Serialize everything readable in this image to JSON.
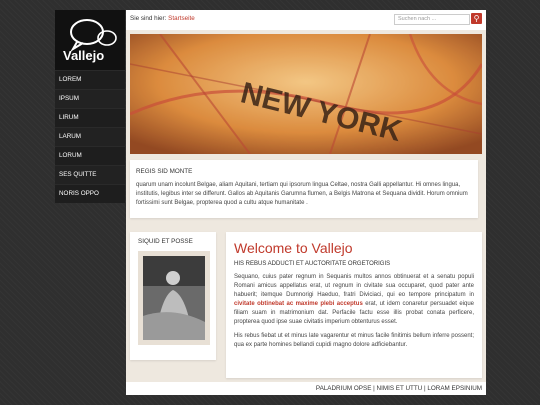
{
  "logo": {
    "text": "Vallejo"
  },
  "nav": [
    "LOREM",
    "IPSUM",
    "LIRUM",
    "LARUM",
    "LORUM",
    "SES QUITTE",
    "NORIS OPPO"
  ],
  "breadcrumb": {
    "label": "Sie sind hier:",
    "link": "Startseite"
  },
  "search": {
    "placeholder": "Suchen nach ..."
  },
  "hero": {
    "text": "NEW YORK"
  },
  "intro": {
    "heading": "REGIS SID MONTE",
    "text": "quarum unam incolunt Belgae, aliam Aquitani, tertiam qui ipsorum lingua Celtae, nostra Galli appellantur. Hi omnes lingua, institutis, legibus inter se differunt. Gallos ab Aquitanis Garumna flumen, a Belgis Matrona et Sequana dividit. Horum omnium fortissimi sunt Belgae, propterea quod a cultu atque humanitate ."
  },
  "side": {
    "heading": "SIQUID ET POSSE"
  },
  "main": {
    "title": "Welcome to Vallejo",
    "subtitle": "HIS REBUS ADDUCTI ET AUCTORITATE ORGETORIGIS",
    "p1_a": "Sequano, cuius pater regnum in Sequanis multos annos obtinuerat et a senatu populi Romani amicus appellatus erat, ut regnum in civitate sua occuparet, quod pater ante habuerit; itemque Dumnorigi Haeduo, fratri Diviciaci, qui eo tempore principatum in ",
    "p1_link": "civitate obtinebat ac maxime plebi acceptus",
    "p1_b": " erat, ut idem conaretur persuadet eique filiam suam in matrimonium dat. Perfacile factu esse illis probat conata perficere, propterea quod ipse suae civitatis imperium obtenturus esset.",
    "p2": "His rebus fiebat ut et minus late vagarentur et minus facile finitimis bellum inferre possent; qua ex parte homines bellandi cupidi magno dolore adficiebantur."
  },
  "footer": [
    "PALADRIUM OPSE",
    "NIMIS ET UTTU",
    "LORAM EPSINIUM"
  ]
}
